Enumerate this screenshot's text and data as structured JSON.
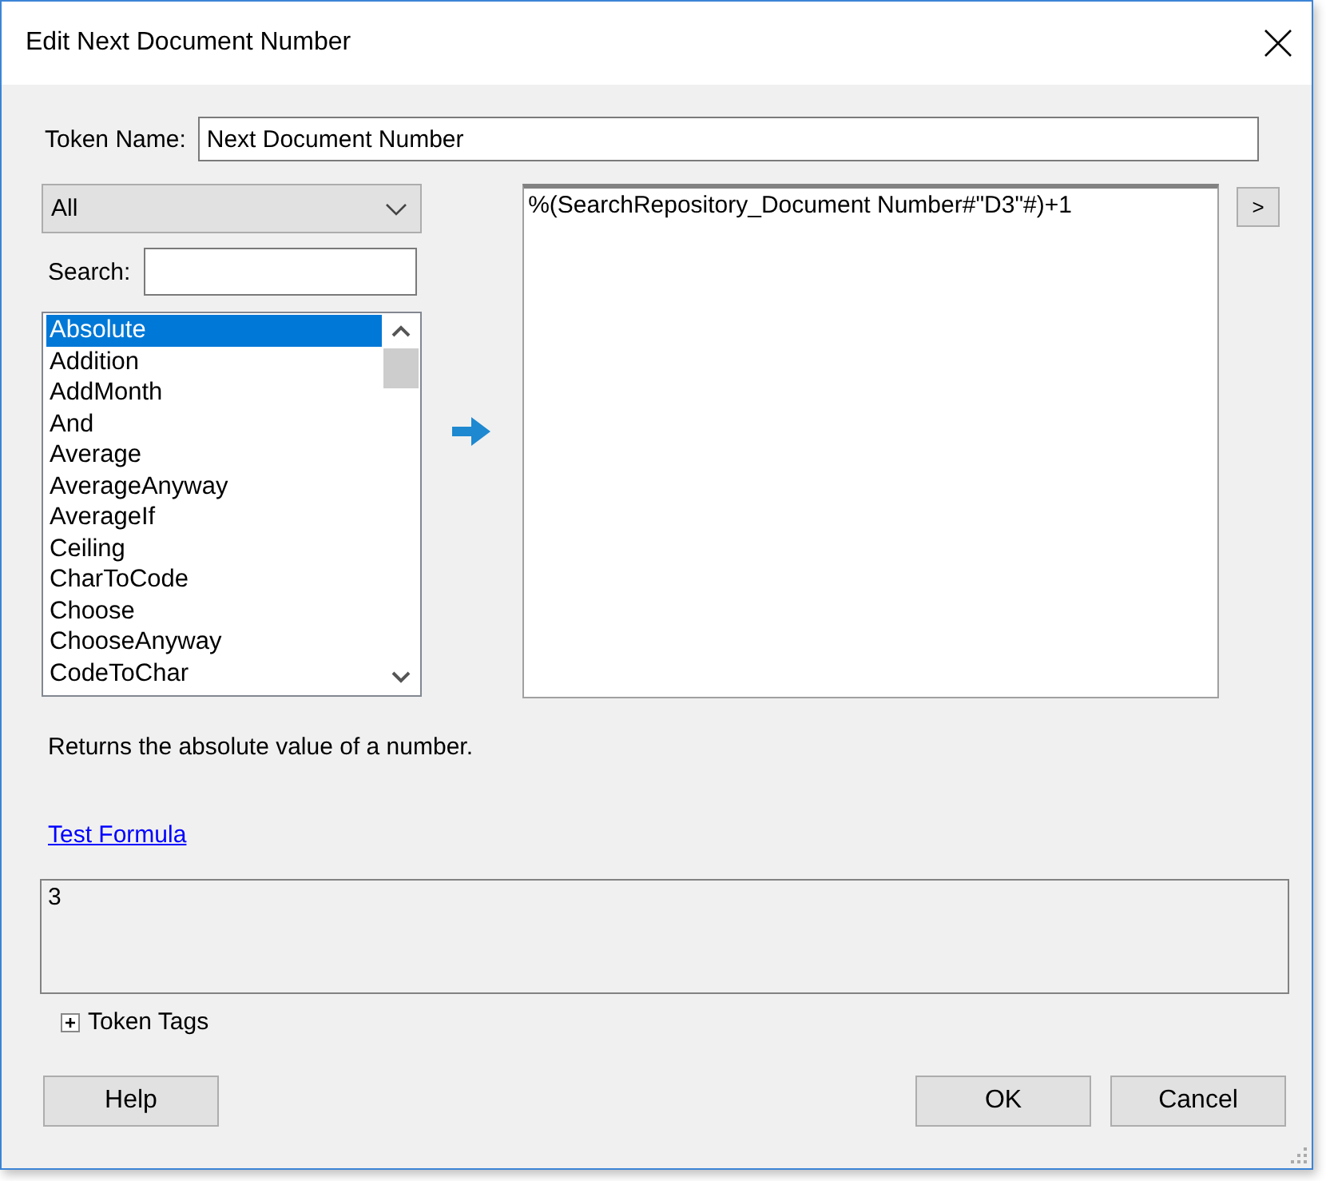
{
  "window": {
    "title": "Edit Next Document Number"
  },
  "token_name": {
    "label": "Token Name:",
    "value": "Next Document Number"
  },
  "category_dropdown": {
    "value": "All"
  },
  "search": {
    "label": "Search:"
  },
  "functions": [
    {
      "label": "Absolute",
      "selected": true
    },
    {
      "label": "Addition",
      "selected": false
    },
    {
      "label": "AddMonth",
      "selected": false
    },
    {
      "label": "And",
      "selected": false
    },
    {
      "label": "Average",
      "selected": false
    },
    {
      "label": "AverageAnyway",
      "selected": false
    },
    {
      "label": "AverageIf",
      "selected": false
    },
    {
      "label": "Ceiling",
      "selected": false
    },
    {
      "label": "CharToCode",
      "selected": false
    },
    {
      "label": "Choose",
      "selected": false
    },
    {
      "label": "ChooseAnyway",
      "selected": false
    },
    {
      "label": "CodeToChar",
      "selected": false
    }
  ],
  "formula": {
    "value": "%(SearchRepository_Document Number#\"D3\"#)+1"
  },
  "insert_button": {
    "label": ">"
  },
  "description": "Returns the absolute value of a number.",
  "test_link": "Test Formula",
  "result": {
    "value": "3"
  },
  "token_tags": {
    "label": "Token Tags",
    "expanded": false
  },
  "buttons": [
    {
      "label": "Help"
    },
    {
      "label": "OK"
    },
    {
      "label": "Cancel"
    }
  ]
}
